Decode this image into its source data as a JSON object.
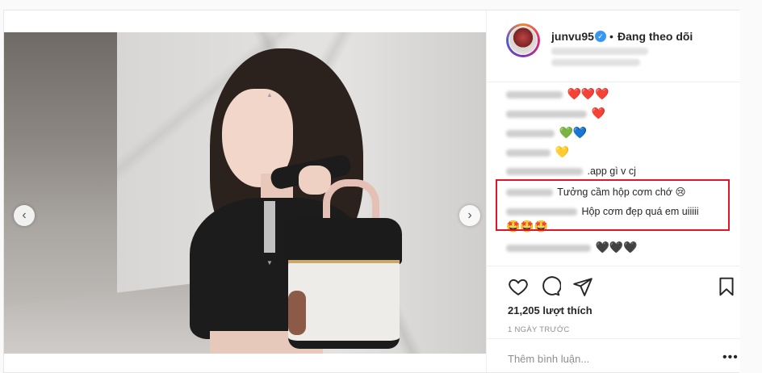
{
  "post": {
    "username": "junvu95",
    "follow_separator": "•",
    "follow_label": "Đang theo dõi",
    "verified_icon": "check-badge-icon",
    "likes": "21,205 lượt thích",
    "time": "1 NGÀY TRƯỚC",
    "add_comment_placeholder": "Thêm bình luận...",
    "more_label": "•••",
    "carousel": {
      "prev": "‹",
      "next": "›"
    }
  },
  "comments": [
    {
      "text": "",
      "emoji": "❤️❤️❤️"
    },
    {
      "text": "",
      "emoji": "❤️"
    },
    {
      "text": "",
      "emoji": "💚💙"
    },
    {
      "text": "",
      "emoji": "💛"
    },
    {
      "text": ".app gì v cj",
      "emoji": ""
    },
    {
      "text": "Tưởng cầm hộp cơm chớ 😢",
      "emoji": ""
    },
    {
      "text": "Hộp cơm đẹp quá em uiiiii",
      "emoji": ""
    },
    {
      "text": "",
      "emoji": "🤩🤩🤩"
    },
    {
      "text": "",
      "emoji": "🖤🖤🖤"
    }
  ],
  "colors": {
    "highlight": "#e0152a",
    "verified": "#3897f0"
  }
}
